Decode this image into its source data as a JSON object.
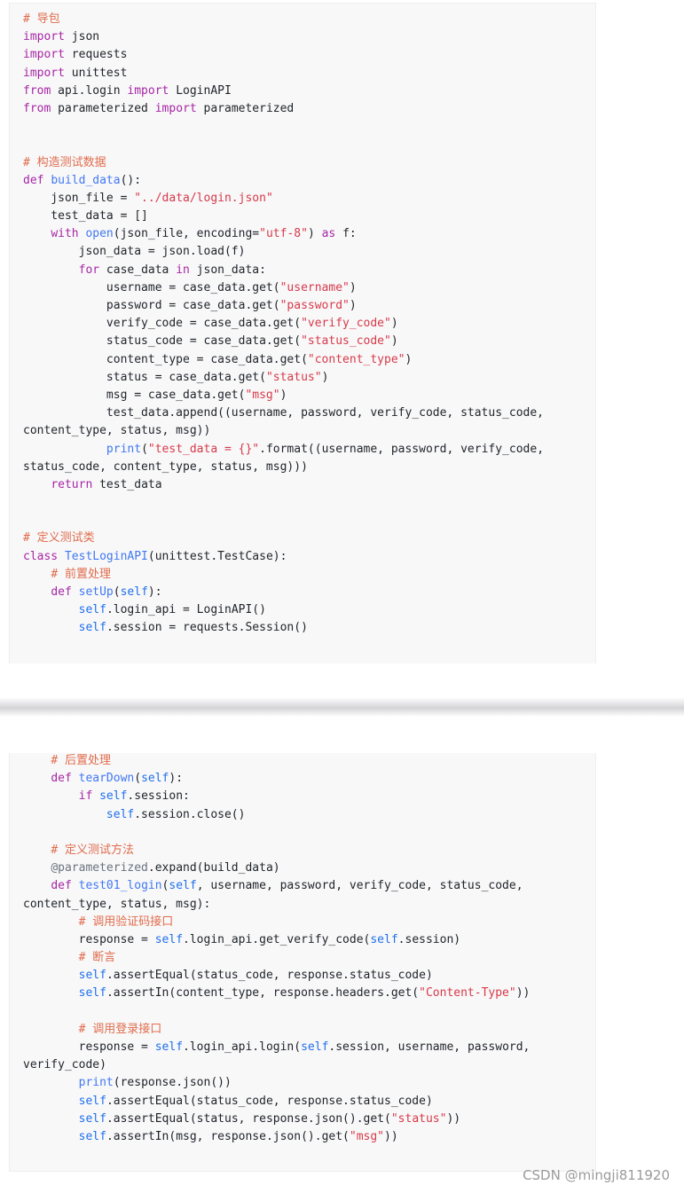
{
  "code_block_1": {
    "lines": [
      "# 导包",
      "import json",
      "import requests",
      "import unittest",
      "from api.login import LoginAPI",
      "from parameterized import parameterized",
      "",
      "",
      "# 构造测试数据",
      "def build_data():",
      "    json_file = \"../data/login.json\"",
      "    test_data = []",
      "    with open(json_file, encoding=\"utf-8\") as f:",
      "        json_data = json.load(f)",
      "        for case_data in json_data:",
      "            username = case_data.get(\"username\")",
      "            password = case_data.get(\"password\")",
      "            verify_code = case_data.get(\"verify_code\")",
      "            status_code = case_data.get(\"status_code\")",
      "            content_type = case_data.get(\"content_type\")",
      "            status = case_data.get(\"status\")",
      "            msg = case_data.get(\"msg\")",
      "            test_data.append((username, password, verify_code, status_code,",
      "content_type, status, msg))",
      "            print(\"test_data = {}\".format((username, password, verify_code,",
      "status_code, content_type, status, msg)))",
      "    return test_data",
      "",
      "",
      "# 定义测试类",
      "class TestLoginAPI(unittest.TestCase):",
      "    # 前置处理",
      "    def setUp(self):",
      "        self.login_api = LoginAPI()",
      "        self.session = requests.Session()"
    ]
  },
  "code_block_2": {
    "lines": [
      "    # 后置处理",
      "    def tearDown(self):",
      "        if self.session:",
      "            self.session.close()",
      "",
      "    # 定义测试方法",
      "    @parameterized.expand(build_data)",
      "    def test01_login(self, username, password, verify_code, status_code,",
      "content_type, status, msg):",
      "        # 调用验证码接口",
      "        response = self.login_api.get_verify_code(self.session)",
      "        # 断言",
      "        self.assertEqual(status_code, response.status_code)",
      "        self.assertIn(content_type, response.headers.get(\"Content-Type\"))",
      "",
      "        # 调用登录接口",
      "        response = self.login_api.login(self.session, username, password,",
      "verify_code)",
      "        print(response.json())",
      "        self.assertEqual(status_code, response.status_code)",
      "        self.assertEqual(status, response.json().get(\"status\"))",
      "        self.assertIn(msg, response.json().get(\"msg\"))"
    ]
  },
  "watermark": "CSDN @mingji811920"
}
